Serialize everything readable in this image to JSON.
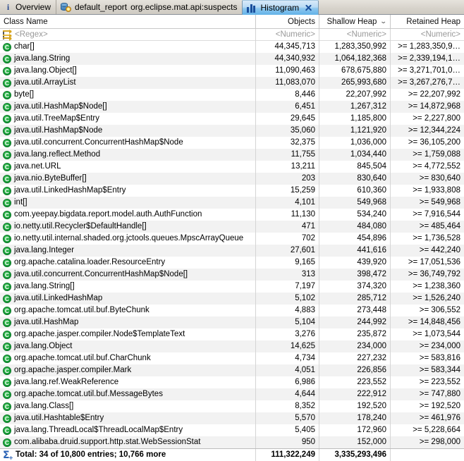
{
  "tabs": [
    {
      "label": "Overview",
      "sub": "",
      "icon": "info-icon",
      "active": false,
      "closable": false
    },
    {
      "label": "default_report",
      "sub": "org.eclipse.mat.api:suspects",
      "icon": "report-icon",
      "active": false,
      "closable": false
    },
    {
      "label": "Histogram",
      "sub": "",
      "icon": "histogram-icon",
      "active": true,
      "closable": true
    }
  ],
  "table": {
    "columns": [
      {
        "key": "name",
        "label": "Class Name",
        "align": "left",
        "sorted": ""
      },
      {
        "key": "objects",
        "label": "Objects",
        "align": "right",
        "sorted": ""
      },
      {
        "key": "shallow",
        "label": "Shallow Heap",
        "align": "right",
        "sorted": "desc"
      },
      {
        "key": "retained",
        "label": "Retained Heap",
        "align": "right",
        "sorted": ""
      }
    ],
    "filter_row": {
      "name": "<Regex>",
      "objects": "<Numeric>",
      "shallow": "<Numeric>",
      "retained": "<Numeric>"
    },
    "rows": [
      {
        "name": "char[]",
        "objects": "44,345,713",
        "shallow": "1,283,350,992",
        "retained": ">= 1,283,350,9…"
      },
      {
        "name": "java.lang.String",
        "objects": "44,340,932",
        "shallow": "1,064,182,368",
        "retained": ">= 2,339,194,1…"
      },
      {
        "name": "java.lang.Object[]",
        "objects": "11,090,463",
        "shallow": "678,675,880",
        "retained": ">= 3,271,701,0…"
      },
      {
        "name": "java.util.ArrayList",
        "objects": "11,083,070",
        "shallow": "265,993,680",
        "retained": ">= 3,267,276,7…"
      },
      {
        "name": "byte[]",
        "objects": "8,446",
        "shallow": "22,207,992",
        "retained": ">= 22,207,992"
      },
      {
        "name": "java.util.HashMap$Node[]",
        "objects": "6,451",
        "shallow": "1,267,312",
        "retained": ">= 14,872,968"
      },
      {
        "name": "java.util.TreeMap$Entry",
        "objects": "29,645",
        "shallow": "1,185,800",
        "retained": ">= 2,227,800"
      },
      {
        "name": "java.util.HashMap$Node",
        "objects": "35,060",
        "shallow": "1,121,920",
        "retained": ">= 12,344,224"
      },
      {
        "name": "java.util.concurrent.ConcurrentHashMap$Node",
        "objects": "32,375",
        "shallow": "1,036,000",
        "retained": ">= 36,105,200"
      },
      {
        "name": "java.lang.reflect.Method",
        "objects": "11,755",
        "shallow": "1,034,440",
        "retained": ">= 1,759,088"
      },
      {
        "name": "java.net.URL",
        "objects": "13,211",
        "shallow": "845,504",
        "retained": ">= 4,772,552"
      },
      {
        "name": "java.nio.ByteBuffer[]",
        "objects": "203",
        "shallow": "830,640",
        "retained": ">= 830,640"
      },
      {
        "name": "java.util.LinkedHashMap$Entry",
        "objects": "15,259",
        "shallow": "610,360",
        "retained": ">= 1,933,808"
      },
      {
        "name": "int[]",
        "objects": "4,101",
        "shallow": "549,968",
        "retained": ">= 549,968"
      },
      {
        "name": "com.yeepay.bigdata.report.model.auth.AuthFunction",
        "objects": "11,130",
        "shallow": "534,240",
        "retained": ">= 7,916,544"
      },
      {
        "name": "io.netty.util.Recycler$DefaultHandle[]",
        "objects": "471",
        "shallow": "484,080",
        "retained": ">= 485,464"
      },
      {
        "name": "io.netty.util.internal.shaded.org.jctools.queues.MpscArrayQueue",
        "objects": "702",
        "shallow": "454,896",
        "retained": ">= 1,736,528"
      },
      {
        "name": "java.lang.Integer",
        "objects": "27,601",
        "shallow": "441,616",
        "retained": ">= 442,240"
      },
      {
        "name": "org.apache.catalina.loader.ResourceEntry",
        "objects": "9,165",
        "shallow": "439,920",
        "retained": ">= 17,051,536"
      },
      {
        "name": "java.util.concurrent.ConcurrentHashMap$Node[]",
        "objects": "313",
        "shallow": "398,472",
        "retained": ">= 36,749,792"
      },
      {
        "name": "java.lang.String[]",
        "objects": "7,197",
        "shallow": "374,320",
        "retained": ">= 1,238,360"
      },
      {
        "name": "java.util.LinkedHashMap",
        "objects": "5,102",
        "shallow": "285,712",
        "retained": ">= 1,526,240"
      },
      {
        "name": "org.apache.tomcat.util.buf.ByteChunk",
        "objects": "4,883",
        "shallow": "273,448",
        "retained": ">= 306,552"
      },
      {
        "name": "java.util.HashMap",
        "objects": "5,104",
        "shallow": "244,992",
        "retained": ">= 14,848,456"
      },
      {
        "name": "org.apache.jasper.compiler.Node$TemplateText",
        "objects": "3,276",
        "shallow": "235,872",
        "retained": ">= 1,073,544"
      },
      {
        "name": "java.lang.Object",
        "objects": "14,625",
        "shallow": "234,000",
        "retained": ">= 234,000"
      },
      {
        "name": "org.apache.tomcat.util.buf.CharChunk",
        "objects": "4,734",
        "shallow": "227,232",
        "retained": ">= 583,816"
      },
      {
        "name": "org.apache.jasper.compiler.Mark",
        "objects": "4,051",
        "shallow": "226,856",
        "retained": ">= 583,344"
      },
      {
        "name": "java.lang.ref.WeakReference",
        "objects": "6,986",
        "shallow": "223,552",
        "retained": ">= 223,552"
      },
      {
        "name": "org.apache.tomcat.util.buf.MessageBytes",
        "objects": "4,644",
        "shallow": "222,912",
        "retained": ">= 747,880"
      },
      {
        "name": "java.lang.Class[]",
        "objects": "8,352",
        "shallow": "192,520",
        "retained": ">= 192,520"
      },
      {
        "name": "java.util.Hashtable$Entry",
        "objects": "5,570",
        "shallow": "178,240",
        "retained": ">= 461,976"
      },
      {
        "name": "java.lang.ThreadLocal$ThreadLocalMap$Entry",
        "objects": "5,405",
        "shallow": "172,960",
        "retained": ">= 5,228,664"
      },
      {
        "name": "com.alibaba.druid.support.http.stat.WebSessionStat",
        "objects": "950",
        "shallow": "152,000",
        "retained": ">= 298,000"
      }
    ],
    "total_row": {
      "name": "Total: 34 of 10,800 entries; 10,766 more",
      "objects": "111,322,249",
      "shallow": "3,335,293,496",
      "retained": ""
    }
  },
  "colors": {
    "class_icon": "#18a038",
    "tab_active": "#63b2e8",
    "sigma_icon": "#2a62b5",
    "regex_icon": "#d7a520"
  }
}
